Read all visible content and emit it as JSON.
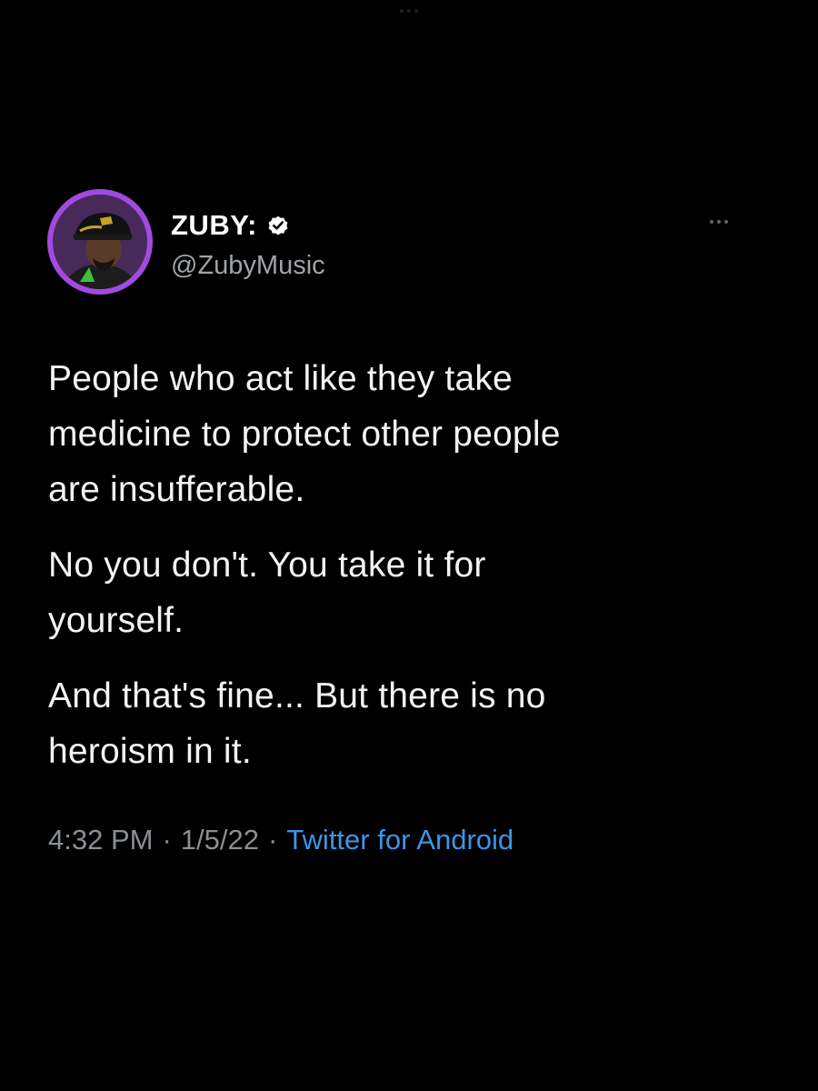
{
  "tweet": {
    "author": {
      "display_name": "ZUBY:",
      "handle": "@ZubyMusic",
      "verified": true,
      "avatar_ring_color": "#a24ae0"
    },
    "body_paragraphs": [
      "People who act like they take\nmedicine to protect other people\nare insufferable.",
      "No you don't. You take it for\nyourself.",
      "And that's fine... But there is no\nheroism in it."
    ],
    "time": "4:32 PM",
    "date": "1/5/22",
    "separator": "·",
    "source": "Twitter for Android",
    "source_color": "#3d95e6"
  },
  "icons": {
    "more": "more-options-icon",
    "verified": "verified-badge-icon"
  }
}
